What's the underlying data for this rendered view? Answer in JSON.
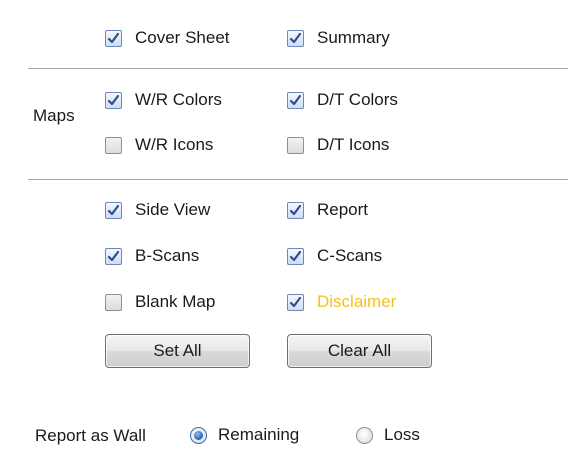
{
  "sections": {
    "maps_label": "Maps"
  },
  "checkboxes": {
    "cover_sheet": {
      "label": "Cover Sheet",
      "checked": true
    },
    "summary": {
      "label": "Summary",
      "checked": true
    },
    "wr_colors": {
      "label": "W/R Colors",
      "checked": true
    },
    "dt_colors": {
      "label": "D/T Colors",
      "checked": true
    },
    "wr_icons": {
      "label": "W/R Icons",
      "checked": false
    },
    "dt_icons": {
      "label": "D/T Icons",
      "checked": false
    },
    "side_view": {
      "label": "Side View",
      "checked": true
    },
    "report": {
      "label": "Report",
      "checked": true
    },
    "b_scans": {
      "label": "B-Scans",
      "checked": true
    },
    "c_scans": {
      "label": "C-Scans",
      "checked": true
    },
    "blank_map": {
      "label": "Blank Map",
      "checked": false
    },
    "disclaimer": {
      "label": "Disclaimer",
      "checked": true
    }
  },
  "buttons": {
    "set_all": "Set All",
    "clear_all": "Clear All"
  },
  "report_as": {
    "label": "Report as Wall",
    "options": {
      "remaining": {
        "label": "Remaining",
        "selected": true
      },
      "loss": {
        "label": "Loss",
        "selected": false
      }
    }
  },
  "colors": {
    "disclaimer_text": "#f2c31b",
    "check_mark": "#2b4f8c",
    "radio_selected": "#2a6fc0"
  },
  "icons": {
    "checkbox_checked": "check-mark",
    "radio_selected": "radio-dot"
  }
}
